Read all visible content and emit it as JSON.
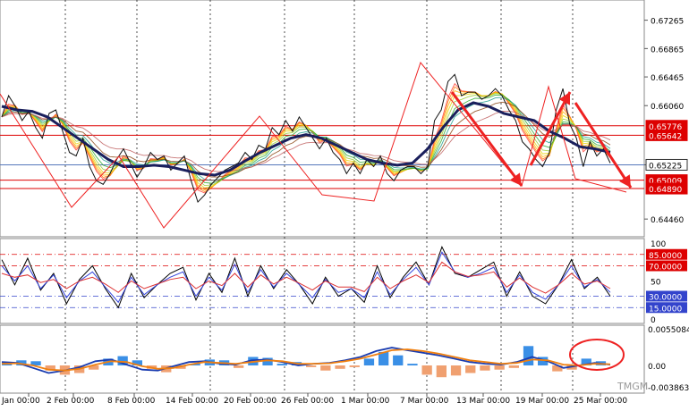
{
  "chart_data": [
    {
      "type": "line",
      "panel": "price",
      "title": "",
      "xlabel": "",
      "ylabel": "",
      "ylim": [
        0.6421,
        0.6755
      ],
      "y_ticks": [
        "0.67265",
        "0.66865",
        "0.66465",
        "0.66060",
        "0.65225",
        "0.64460"
      ],
      "x_labels": [
        "Jan 00:00",
        "2 Feb 00:00",
        "8 Feb 00:00",
        "14 Feb 00:00",
        "20 Feb 00:00",
        "26 Feb 00:00",
        "1 Mar 00:00",
        "7 Mar 00:00",
        "13 Mar 00:00",
        "19 Mar 00:00",
        "25 Mar 00:00"
      ],
      "series": [
        {
          "name": "",
          "kind": "close",
          "values": [
            0.659,
            0.662,
            0.6605,
            0.6585,
            0.6598,
            0.6575,
            0.656,
            0.6595,
            0.66,
            0.657,
            0.654,
            0.6535,
            0.656,
            0.652,
            0.65,
            0.6495,
            0.651,
            0.653,
            0.6545,
            0.6525,
            0.6505,
            0.652,
            0.654,
            0.653,
            0.6535,
            0.6515,
            0.6525,
            0.6535,
            0.65,
            0.647,
            0.648,
            0.6495,
            0.6505,
            0.6515,
            0.652,
            0.6525,
            0.654,
            0.653,
            0.655,
            0.6545,
            0.6575,
            0.6565,
            0.6585,
            0.657,
            0.659,
            0.6575,
            0.656,
            0.6545,
            0.656,
            0.654,
            0.653,
            0.651,
            0.6525,
            0.651,
            0.653,
            0.652,
            0.6535,
            0.651,
            0.65,
            0.6515,
            0.652,
            0.652,
            0.651,
            0.652,
            0.6585,
            0.66,
            0.664,
            0.665,
            0.662,
            0.6625,
            0.6625,
            0.6615,
            0.662,
            0.663,
            0.662,
            0.66,
            0.6585,
            0.6555,
            0.6545,
            0.653,
            0.652,
            0.654,
            0.66,
            0.663,
            0.658,
            0.656,
            0.652,
            0.6555,
            0.6535,
            0.6545,
            0.6525
          ]
        },
        {
          "name": "",
          "kind": "ma_slow",
          "values": [
            0.6605,
            0.66,
            0.6598,
            0.659,
            0.6575,
            0.656,
            0.6545,
            0.653,
            0.652,
            0.652,
            0.6522,
            0.652,
            0.6515,
            0.651,
            0.6508,
            0.6515,
            0.6528,
            0.654,
            0.655,
            0.656,
            0.6565,
            0.656,
            0.655,
            0.654,
            0.653,
            0.6525,
            0.6522,
            0.6525,
            0.6545,
            0.6575,
            0.66,
            0.661,
            0.6605,
            0.6595,
            0.659,
            0.6585,
            0.657,
            0.656,
            0.6548,
            0.6545,
            0.654
          ]
        }
      ],
      "levels": [
        {
          "label": "0.65776",
          "value": 0.65776,
          "color": "#dd0000"
        },
        {
          "label": "0.65642",
          "value": 0.65642,
          "color": "#dd0000"
        },
        {
          "label": "0.65225",
          "value": 0.65225,
          "color": "#5577bb"
        },
        {
          "label": "0.65009",
          "value": 0.65009,
          "color": "#dd0000"
        },
        {
          "label": "0.64890",
          "value": 0.6489,
          "color": "#dd0000"
        }
      ]
    },
    {
      "type": "line",
      "panel": "oscillator",
      "ylim": [
        0,
        100
      ],
      "y_ticks": [
        "100",
        "50",
        "0"
      ],
      "levels": [
        {
          "label": "85.0000",
          "value": 85,
          "color": "#dd0000"
        },
        {
          "label": "70.0000",
          "value": 70,
          "color": "#dd0000"
        },
        {
          "label": "30.0000",
          "value": 30,
          "color": "#3344cc"
        },
        {
          "label": "15.0000",
          "value": 15,
          "color": "#3344cc"
        }
      ],
      "series": [
        {
          "name": "",
          "color": "#000000",
          "values": [
            78,
            45,
            80,
            38,
            60,
            20,
            52,
            70,
            40,
            15,
            60,
            28,
            45,
            60,
            68,
            25,
            60,
            35,
            80,
            30,
            70,
            40,
            65,
            45,
            20,
            55,
            30,
            40,
            22,
            70,
            28,
            55,
            75,
            45,
            95,
            60,
            55,
            65,
            75,
            30,
            62,
            30,
            20,
            45,
            78,
            40,
            55,
            30
          ]
        },
        {
          "name": "",
          "color": "#3344dd",
          "values": [
            70,
            50,
            70,
            40,
            58,
            28,
            50,
            62,
            42,
            22,
            55,
            32,
            45,
            55,
            62,
            30,
            55,
            38,
            72,
            35,
            65,
            42,
            60,
            45,
            28,
            52,
            35,
            40,
            28,
            62,
            32,
            52,
            68,
            45,
            88,
            62,
            55,
            60,
            68,
            35,
            58,
            35,
            26,
            45,
            70,
            42,
            52,
            35
          ]
        },
        {
          "name": "",
          "color": "#dd3333",
          "values": [
            60,
            55,
            58,
            48,
            52,
            40,
            50,
            55,
            46,
            35,
            50,
            40,
            46,
            52,
            55,
            40,
            50,
            44,
            60,
            42,
            58,
            46,
            55,
            47,
            38,
            50,
            42,
            42,
            36,
            55,
            40,
            50,
            58,
            48,
            75,
            62,
            56,
            58,
            62,
            42,
            54,
            42,
            34,
            45,
            60,
            46,
            50,
            40
          ]
        }
      ]
    },
    {
      "type": "bar",
      "panel": "macd",
      "y_ticks": [
        "0.0055084",
        "0.00",
        "-0.0038636"
      ],
      "series": [
        {
          "name": "",
          "kind": "histogram",
          "values": [
            0.0008,
            0.0012,
            0.001,
            -0.0012,
            -0.0022,
            -0.0018,
            -0.001,
            0.0016,
            0.0022,
            0.0012,
            -0.0008,
            -0.0016,
            -0.0008,
            0.0004,
            0.0014,
            0.0012,
            -0.0006,
            0.002,
            0.0018,
            0.0004,
            0.0008,
            -0.0004,
            -0.0012,
            -0.0008,
            -0.0004,
            0.0016,
            0.0032,
            0.0024,
            0.0004,
            -0.0022,
            -0.0028,
            -0.0024,
            -0.0018,
            -0.0012,
            -0.001,
            -0.0006,
            0.0046,
            0.002,
            -0.0014,
            -0.001,
            0.0016,
            0.001
          ]
        },
        {
          "name": "",
          "kind": "macd_line",
          "color": "#1a3cb0",
          "values": [
            0.0008,
            0.0006,
            -0.0006,
            -0.0018,
            -0.0012,
            -0.0004,
            0.001,
            0.0014,
            0.0002,
            -0.001,
            -0.0012,
            -0.0002,
            0.0008,
            0.001,
            0.0004,
            0.0002,
            0.0012,
            0.0014,
            0.0008,
            0.0,
            0.0004,
            0.0006,
            0.0012,
            0.002,
            0.0034,
            0.0042,
            0.0036,
            0.003,
            0.0024,
            0.0016,
            0.0008,
            0.0004,
            0.0002,
            0.0008,
            0.002,
            0.001,
            -0.0006,
            0.0,
            0.0006,
            0.0002
          ]
        },
        {
          "name": "",
          "kind": "signal_line",
          "color": "#f08010",
          "values": [
            0.0004,
            0.0005,
            0.0,
            -0.001,
            -0.0012,
            -0.0008,
            0.0002,
            0.001,
            0.0008,
            -0.0002,
            -0.0008,
            -0.0006,
            0.0002,
            0.0008,
            0.0006,
            0.0004,
            0.0008,
            0.0012,
            0.001,
            0.0004,
            0.0004,
            0.0005,
            0.001,
            0.0016,
            0.0026,
            0.0036,
            0.0038,
            0.0034,
            0.0028,
            0.002,
            0.0012,
            0.0008,
            0.0004,
            0.0006,
            0.0014,
            0.0012,
            0.0002,
            0.0,
            0.0004,
            0.0003
          ]
        }
      ]
    }
  ],
  "colors": {
    "arrow": "#ee2222",
    "background": "#ffffff",
    "grid": "#000000"
  },
  "watermark": "TMGM"
}
